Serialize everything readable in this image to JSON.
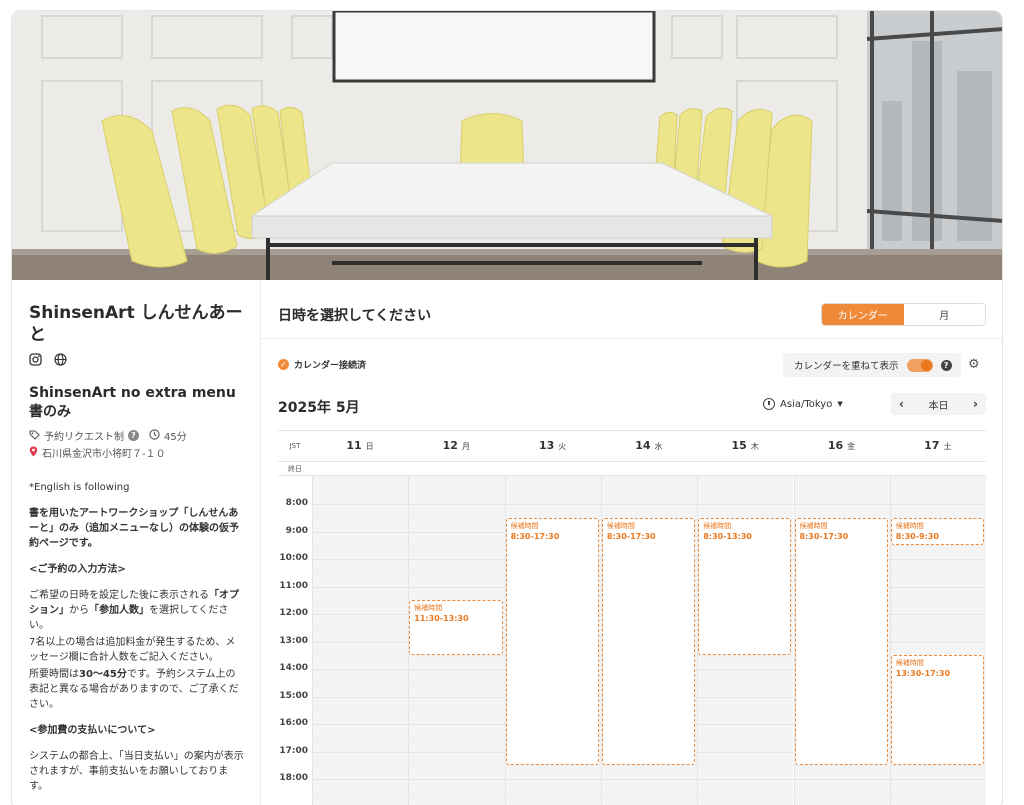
{
  "shop": {
    "title": "ShinsenArt しんせんあーと",
    "menu_title": "ShinsenArt no extra menu 書のみ",
    "request_type": "予約リクエスト制",
    "duration": "45分",
    "address": "石川県金沢市小将町７-１０"
  },
  "description": {
    "p1": "*English is following",
    "p2": "書を用いたアートワークショップ「しんせんあーと」のみ（追加メニューなし）の体験の仮予約ページです。",
    "p3": "<ご予約の入力方法>",
    "p4a": "ご希望の日時を設定した後に表示される",
    "p4b": "「オプション」",
    "p4c": "から",
    "p4d": "「参加人数」",
    "p4e": "を選択してください。",
    "p5": "7名以上の場合は追加料金が発生するため、メッセージ欄に合計人数をご記入ください。",
    "p6a": "所要時間は",
    "p6b": "30〜45分",
    "p6c": "です。予約システム上の表記と異なる場合がありますので、ご了承ください。",
    "p7": "<参加費の支払いについて>",
    "p8": "システムの都合上、「当日支払い」の案内が表示されますが、事前支払いをお願いしております。"
  },
  "header": {
    "title": "日時を選択してください",
    "seg_calendar": "カレンダー",
    "seg_month": "月"
  },
  "toolbar": {
    "connected": "カレンダー接続済",
    "overlay_label": "カレンダーを重ねて表示",
    "overlay_on": true,
    "month_label": "2025年 5月",
    "timezone": "Asia/Tokyo",
    "today": "本日"
  },
  "calendar": {
    "tz_short": "JST",
    "allday_label": "終日",
    "days": [
      {
        "num": "11",
        "dow": "日"
      },
      {
        "num": "12",
        "dow": "月"
      },
      {
        "num": "13",
        "dow": "火"
      },
      {
        "num": "14",
        "dow": "水"
      },
      {
        "num": "15",
        "dow": "木"
      },
      {
        "num": "16",
        "dow": "金"
      },
      {
        "num": "17",
        "dow": "土"
      }
    ],
    "hours": [
      "8:00",
      "9:00",
      "10:00",
      "11:00",
      "12:00",
      "13:00",
      "14:00",
      "15:00",
      "16:00",
      "17:00",
      "18:00"
    ],
    "slot_kind": "候補時間",
    "slots": [
      {
        "day": 1,
        "start": "11:30",
        "end": "13:30",
        "label": "11:30-13:30"
      },
      {
        "day": 2,
        "start": "8:30",
        "end": "17:30",
        "label": "8:30-17:30"
      },
      {
        "day": 3,
        "start": "8:30",
        "end": "17:30",
        "label": "8:30-17:30"
      },
      {
        "day": 4,
        "start": "8:30",
        "end": "13:30",
        "label": "8:30-13:30"
      },
      {
        "day": 5,
        "start": "8:30",
        "end": "17:30",
        "label": "8:30-17:30"
      },
      {
        "day": 6,
        "start": "8:30",
        "end": "9:30",
        "label": "8:30-9:30"
      },
      {
        "day": 6,
        "start": "13:30",
        "end": "17:30",
        "label": "13:30-17:30"
      }
    ]
  },
  "colors": {
    "accent": "#ee8a3a",
    "accent_dark": "#e9781f"
  }
}
